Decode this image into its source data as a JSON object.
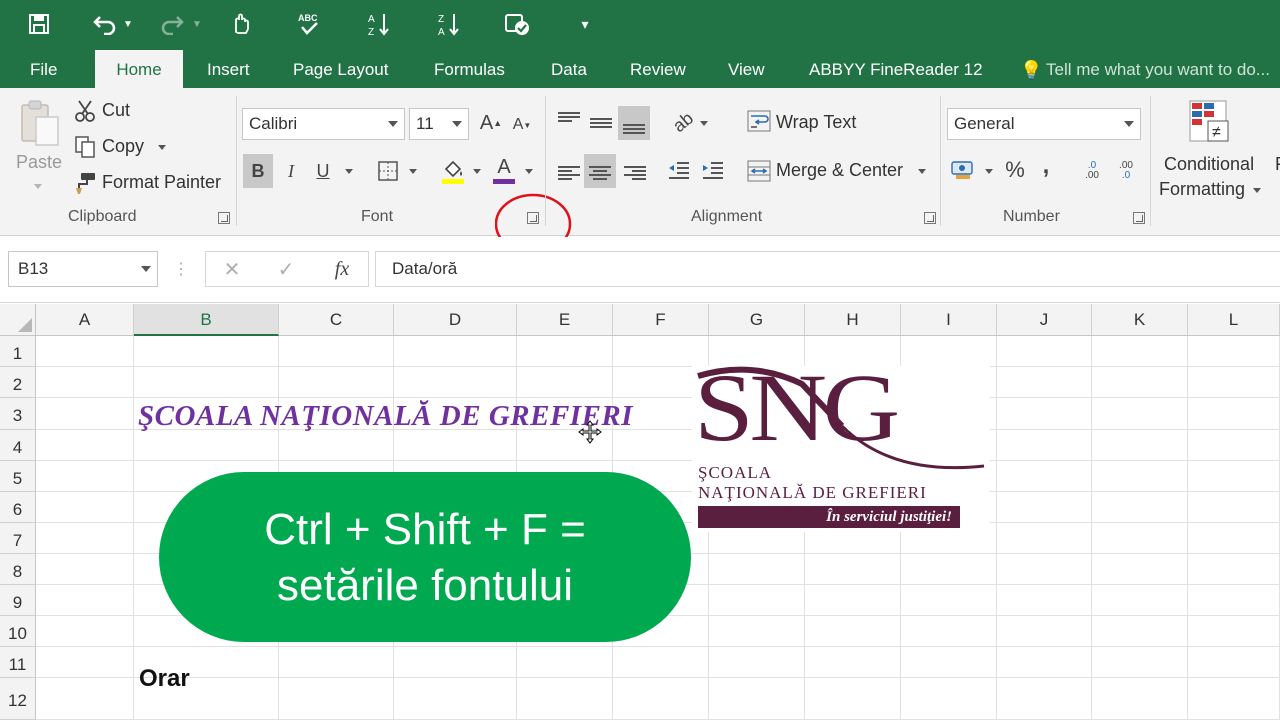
{
  "tabs": [
    "File",
    "Home",
    "Insert",
    "Page Layout",
    "Formulas",
    "Data",
    "Review",
    "View",
    "ABBYY FineReader 12"
  ],
  "tell_me": "Tell me what you want to do...",
  "clipboard": {
    "paste": "Paste",
    "cut": "Cut",
    "copy": "Copy",
    "format_painter": "Format Painter",
    "label": "Clipboard"
  },
  "font": {
    "name": "Calibri",
    "size": "11",
    "bold": "B",
    "italic": "I",
    "underline": "U",
    "color_letter": "A",
    "label": "Font"
  },
  "alignment": {
    "wrap_text": "Wrap Text",
    "merge_center": "Merge & Center",
    "label": "Alignment"
  },
  "number": {
    "format": "General",
    "percent": "%",
    "comma": ",",
    "inc_decimal": ".00",
    "dec_decimal": ".0",
    "label": "Number"
  },
  "styles": {
    "conditional_line1": "Conditional",
    "conditional_line2": "Formatting",
    "next": "Fo"
  },
  "formula_bar": {
    "name_box": "B13",
    "fx": "fx",
    "value": "Data/oră"
  },
  "columns": [
    "A",
    "B",
    "C",
    "D",
    "E",
    "F",
    "G",
    "H",
    "I",
    "J",
    "K",
    "L"
  ],
  "rows": [
    "1",
    "2",
    "3",
    "4",
    "5",
    "6",
    "7",
    "8",
    "9",
    "10",
    "11",
    "12"
  ],
  "cells": {
    "b3": "ŞCOALA NAŢIONALĂ DE GREFIERI",
    "b11": "Orar"
  },
  "logo": {
    "mark": "SNG",
    "line1": "ŞCOALA",
    "line2": "NAŢIONALĂ DE GREFIERI",
    "tagline": "În serviciul justiţiei!"
  },
  "overlay": {
    "line1": "Ctrl + Shift + F =",
    "line2": "setările fontului"
  },
  "colors": {
    "excel_green": "#217346",
    "title_purple": "#7030a0",
    "logo_purple": "#5a1e3e",
    "overlay_green": "#00a94f",
    "highlight_red": "#e0101a"
  }
}
